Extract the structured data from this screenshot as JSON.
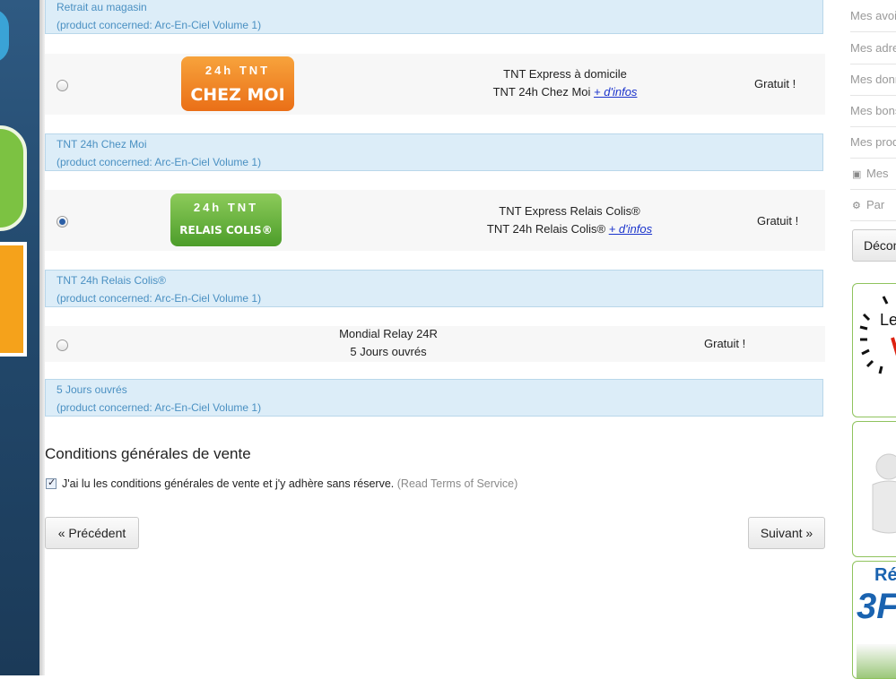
{
  "carriers": {
    "pickup_note": {
      "line1": "Retrait au magasin",
      "line2": "(product concerned: Arc-En-Ciel Volume 1)"
    },
    "chez_moi": {
      "logo_top": "24h TNT",
      "logo_text": "CHEZ MOI",
      "name": "TNT Express à domicile",
      "service": "TNT 24h Chez Moi",
      "infos_link": "+ d'infos",
      "price": "Gratuit !",
      "selected": false,
      "note_line1": "TNT 24h Chez Moi",
      "note_line2": "(product concerned: Arc-En-Ciel Volume 1)"
    },
    "relais": {
      "logo_top": "24h TNT",
      "logo_text": "RELAIS COLIS®",
      "name": "TNT Express Relais Colis®",
      "service": "TNT 24h Relais Colis®",
      "infos_link": "+ d'infos",
      "price": "Gratuit !",
      "selected": true,
      "note_line1": "TNT 24h Relais Colis®",
      "note_line2": "(product concerned: Arc-En-Ciel Volume 1)"
    },
    "mondial": {
      "name": "Mondial Relay 24R",
      "service": "5 Jours ouvrés",
      "price": "Gratuit !",
      "selected": false,
      "note_line1": "5 Jours ouvrés",
      "note_line2": "(product concerned: Arc-En-Ciel Volume 1)"
    }
  },
  "terms": {
    "title": "Conditions générales de vente",
    "checkbox_label": "J'ai lu les conditions générales de vente et j'y adhère sans réserve.",
    "link": "(Read Terms of Service)",
    "checked": true
  },
  "nav": {
    "prev": "« Précédent",
    "next": "Suivant »"
  },
  "sidebar": {
    "items": [
      {
        "label": "Mes avoirs"
      },
      {
        "label": "Mes adresses"
      },
      {
        "label": "Mes données"
      },
      {
        "label": "Mes bons"
      },
      {
        "label": "Mes produits"
      },
      {
        "label": "Mes",
        "icon": "money-icon"
      },
      {
        "label": "Par",
        "icon": "gears-icon"
      }
    ],
    "button": "Déconnexion",
    "banner_top_text": "Le",
    "banner_bottom_text1": "Ré",
    "banner_bottom_text2": "3F"
  },
  "colors": {
    "note_bg": "#dcedf8",
    "note_text": "#4a90c2",
    "link": "#1a33cc",
    "tnt_orange": "#ea6f17",
    "tnt_green": "#4c9d2a"
  }
}
